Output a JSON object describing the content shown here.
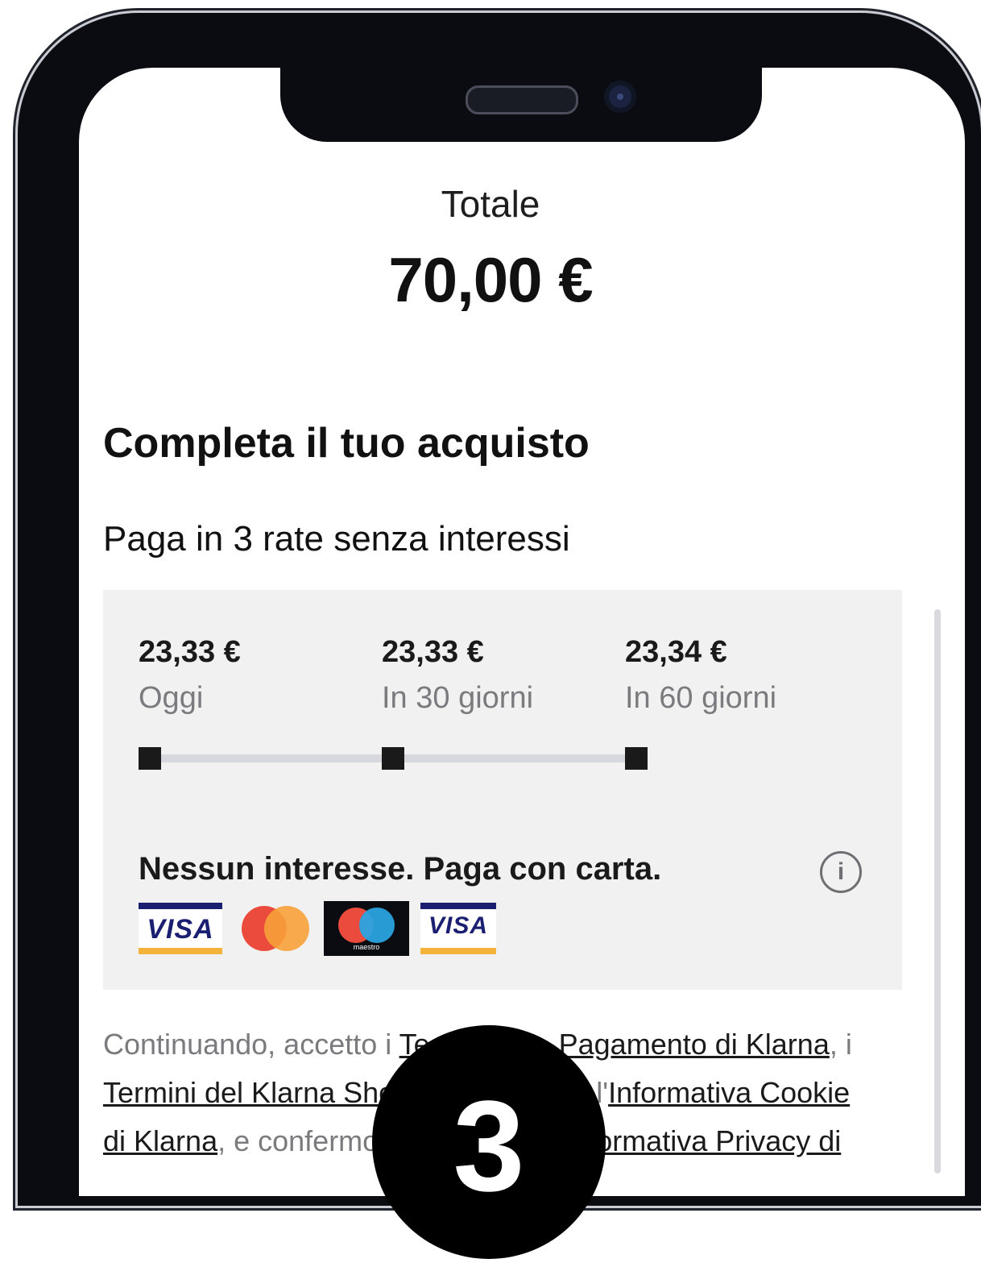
{
  "total": {
    "label": "Totale",
    "amount": "70,00 €"
  },
  "checkout": {
    "title": "Completa il tuo acquisto",
    "plan_title": "Paga in 3 rate senza interessi",
    "installments": [
      {
        "amount": "23,33 €",
        "when": "Oggi"
      },
      {
        "amount": "23,33 €",
        "when": "In 30 giorni"
      },
      {
        "amount": "23,34 €",
        "when": "In 60 giorni"
      }
    ],
    "card_notice": "Nessun interesse. Paga con carta.",
    "card_brands": {
      "visa": "VISA",
      "visa_electron": "VISA",
      "maestro": "maestro"
    },
    "info_icon": "i"
  },
  "legal": {
    "line1_prefix": "Continuando, accetto i ",
    "link_terms_partial": "Te",
    "link_payment_terms": "Pagamento di Klarna",
    "line1_suffix": ", i",
    "link_shopping_terms": "Termini del Klarna Sho",
    "line2_mid": " l'",
    "link_cookie": "Informativa Cookie",
    "line3_start": "di Klarna",
    "line3_mid": ", e confermo",
    "line3_end": "ormativa Privacy di"
  },
  "badge": {
    "step": "3"
  },
  "colors": {
    "card_bg": "#f1f1f2",
    "muted_text": "#7b7b7f",
    "visa_blue": "#1a1f71",
    "visa_gold": "#f4b43c",
    "mastercard_red": "#eb4b3c",
    "mastercard_orange": "#f7a13a",
    "maestro_blue": "#2aa3e0"
  }
}
